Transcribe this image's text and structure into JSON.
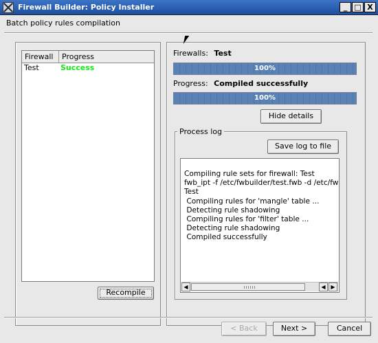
{
  "window": {
    "title": "Firewall Builder: Policy Installer",
    "min_label": "_",
    "max_label": "□",
    "close_label": "X"
  },
  "heading": "Batch policy rules compilation",
  "firewall_list": {
    "columns": [
      "Firewall",
      "Progress"
    ],
    "rows": [
      {
        "firewall": "Test",
        "progress": "Success",
        "progress_color": "#19e619"
      }
    ]
  },
  "recompile_label": "Recompile",
  "status": {
    "firewalls_label": "Firewalls:",
    "firewalls_value": "Test",
    "firewalls_progress_text": "100%",
    "firewalls_progress_fraction": 1.0,
    "progress_label": "Progress:",
    "progress_value": "Compiled successfully",
    "progress_text": "100%",
    "progress_fraction": 1.0
  },
  "hide_details_label": "Hide details",
  "process_log": {
    "title": "Process log",
    "save_label": "Save log to file",
    "lines": [
      "Compiling rule sets for firewall: Test",
      "fwb_ipt -f /etc/fwbuilder/test.fwb -d /etc/fwbu",
      "Test",
      " Compiling rules for 'mangle' table ...",
      " Detecting rule shadowing",
      " Compiling rules for 'filter' table ...",
      " Detecting rule shadowing",
      " Compiled successfully"
    ]
  },
  "footer": {
    "back_label": "< Back",
    "next_label": "Next >",
    "cancel_label": "Cancel"
  },
  "colors": {
    "titlebar": "#2a5fb0",
    "progress_fill": "#5a82b5",
    "success": "#19e619"
  }
}
